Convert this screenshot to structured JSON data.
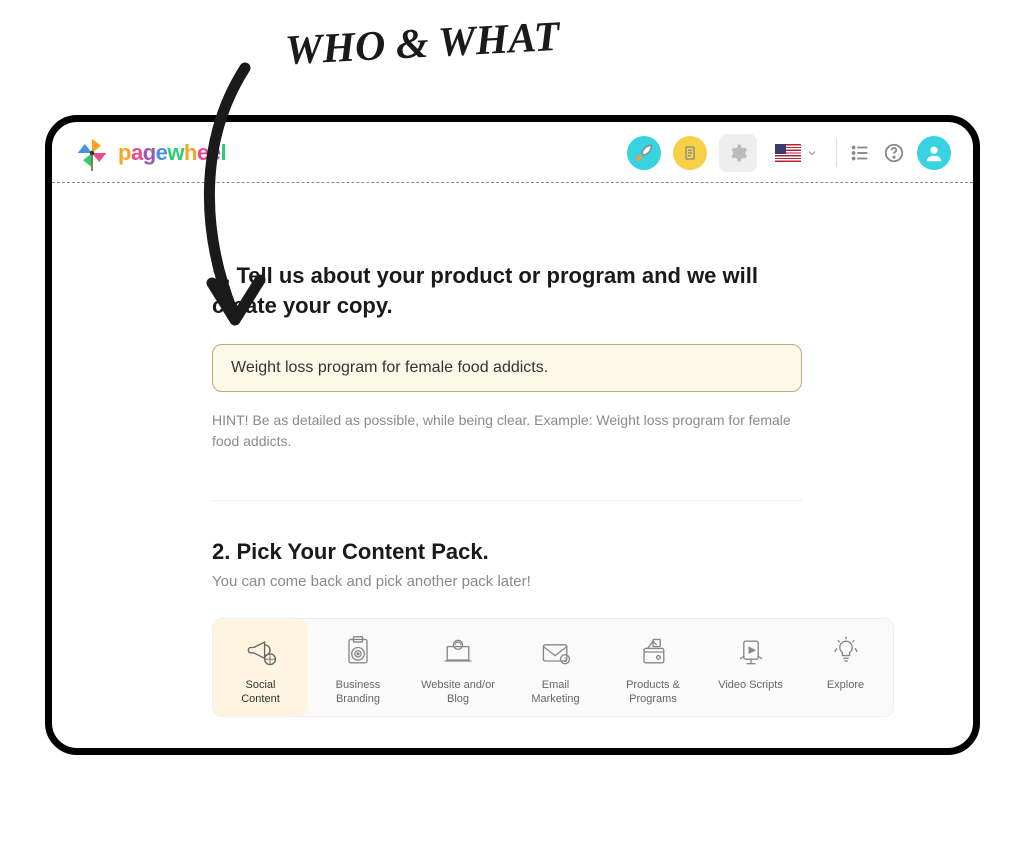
{
  "annotation": {
    "text": "WHO & WHAT"
  },
  "header": {
    "brand": "pagewheel",
    "language": "en-US"
  },
  "section1": {
    "title": "1. Tell us about your product or program and we will create your copy.",
    "input_value": "Weight loss program for female food addicts.",
    "hint": "HINT! Be as detailed as possible, while being clear. Example: Weight loss program for female food addicts."
  },
  "section2": {
    "title": "2. Pick Your Content Pack.",
    "subtitle": "You can come back and pick another pack later!"
  },
  "packs": [
    {
      "label": "Social Content",
      "icon": "megaphone",
      "selected": true
    },
    {
      "label": "Business Branding",
      "icon": "target",
      "selected": false
    },
    {
      "label": "Website and/or Blog",
      "icon": "laptop",
      "selected": false
    },
    {
      "label": "Email Marketing",
      "icon": "envelope",
      "selected": false
    },
    {
      "label": "Products & Programs",
      "icon": "wallet",
      "selected": false
    },
    {
      "label": "Video Scripts",
      "icon": "video",
      "selected": false
    },
    {
      "label": "Explore",
      "icon": "lightbulb",
      "selected": false
    }
  ]
}
